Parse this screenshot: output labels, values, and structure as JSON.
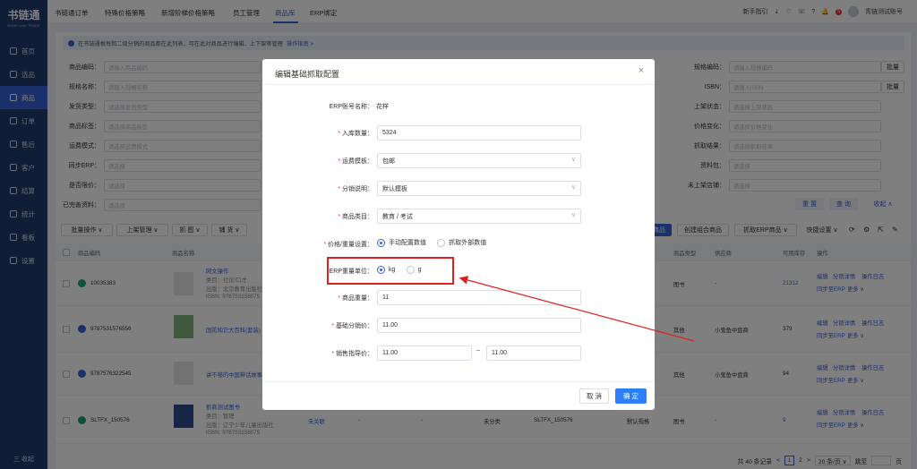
{
  "app": {
    "logo": "书链通",
    "logo_sub": "BOOK LINK TRADE"
  },
  "sidebar": {
    "items": [
      {
        "label": "首页",
        "active": false
      },
      {
        "label": "选品",
        "active": false
      },
      {
        "label": "商品",
        "active": true
      },
      {
        "label": "订单",
        "active": false
      },
      {
        "label": "售后",
        "active": false
      },
      {
        "label": "客户",
        "active": false
      },
      {
        "label": "结算",
        "active": false
      },
      {
        "label": "统计",
        "active": false
      },
      {
        "label": "看板",
        "active": false
      },
      {
        "label": "设置",
        "active": false
      }
    ],
    "collapse": "三 收起"
  },
  "topbar": {
    "tabs": [
      "书链通订单",
      "特殊价格策略",
      "新增阶梯价格策略",
      "员工管理",
      "商品库",
      "ERP绑定"
    ],
    "active_tab": "商品库",
    "guide": "新手指引",
    "badge": "5",
    "user": "青链测试账号"
  },
  "notice": {
    "text": "在书链通根每和二级分销的商品都在此列表，可在此对商品进行编辑、上下架等管理",
    "link": "操作指南 >"
  },
  "filters": {
    "left": [
      {
        "label": "商品编码：",
        "placeholder": "请输入商品编码"
      },
      {
        "label": "规格名称：",
        "placeholder": "请输入规格名称"
      },
      {
        "label": "发货类型：",
        "placeholder": "请选择发货类型"
      },
      {
        "label": "商品标签：",
        "placeholder": "请选择商品标签"
      },
      {
        "label": "运费模式：",
        "placeholder": "请选择运费模式"
      },
      {
        "label": "同步ERP：",
        "placeholder": "请选择"
      },
      {
        "label": "是否限价：",
        "placeholder": "请选择"
      }
    ],
    "right": [
      {
        "label": "规格编码：",
        "placeholder": "请输入规格编码"
      },
      {
        "label": "ISBN：",
        "placeholder": "请输入ISBN"
      },
      {
        "label": "上架状态：",
        "placeholder": "请选择上架状态"
      },
      {
        "label": "价格变化：",
        "placeholder": "请选择价格变化"
      },
      {
        "label": "抓取结果：",
        "placeholder": "请选择抓取结果"
      },
      {
        "label": "资料包：",
        "placeholder": "请选择"
      },
      {
        "label": "未上架店铺：",
        "placeholder": "请选择"
      }
    ],
    "batch": "批量",
    "complete_label": "已完善资料：",
    "complete_placeholder": "请选择",
    "reset": "重 置",
    "search": "查 询",
    "fold": "收起 ∧"
  },
  "toolbar": {
    "left": [
      "批量操作 ∨",
      "上架管理 ∨",
      "抓 图 ∨",
      "铺 货 ∨"
    ],
    "right": [
      "商品",
      "创建组合商品",
      "抓取ERP商品 ∨",
      "快捷设置 ∨"
    ]
  },
  "table": {
    "headers": [
      "商品编码",
      "商品名称",
      "商品类型",
      "供应商",
      "可用库存",
      "操作"
    ],
    "rows": [
      {
        "code": "10035383",
        "name": "网文操作",
        "meta": [
          "类目：社论/口才",
          "出版：北京教育出版社",
          "ISBN: 978753158075"
        ],
        "type": "图书",
        "supplier": "-",
        "stock": "21312",
        "stock_link": true
      },
      {
        "code": "9787531576556",
        "name": "国防知识大百科(套装)",
        "meta": [],
        "type": "其他",
        "supplier": "小鬼鱼中盘商",
        "stock": "379",
        "stock_link": false
      },
      {
        "code": "9787576322545",
        "name": "讲不够的中国神话故事",
        "meta": [],
        "type": "其他",
        "supplier": "小鬼鱼中盘商",
        "stock": "94",
        "stock_link": false
      },
      {
        "code": "SLTFX_150576",
        "name": "抓商测试图书",
        "meta": [
          "类目：管理",
          "出版：辽宁少年儿童出版社",
          "ISBN: 978753158075"
        ],
        "type": "图书",
        "supplier": "-",
        "stock": "9",
        "stock_link": true,
        "extra": [
          "未关联",
          "-",
          "-",
          "未分类",
          "SLTFX_150576",
          "默认规格"
        ]
      }
    ],
    "ops": [
      "编辑",
      "分销详情",
      "操作日志",
      "同步至ERP",
      "更多 ∨"
    ]
  },
  "pager": {
    "total": "共 40 条记录",
    "prev": "<",
    "page1": "1",
    "page2": "2",
    "next": ">",
    "size": "20 条/页 ∨",
    "goto": "跳至",
    "page_unit": "页"
  },
  "modal": {
    "title": "编辑基础抓取配置",
    "close": "×",
    "erp_label": "ERP账号名称：",
    "erp_value": "花样",
    "stock_label": "入库数量：",
    "stock_value": "5324",
    "freight_label": "运费模板：",
    "freight_value": "包邮",
    "dist_label": "分销说明：",
    "dist_value": "默认模板",
    "cat_label": "商品类目：",
    "cat_value": "教育 / 考试",
    "price_label": "价格/重量设置：",
    "price_opt1": "手动配置数值",
    "price_opt2": "抓取外部数值",
    "unit_label": "ERP重量单位：",
    "unit_kg": "kg",
    "unit_g": "g",
    "weight_label": "商品重量：",
    "weight_value": "11",
    "base_price_label": "基础分销价：",
    "base_price_value": "11.00",
    "guide_price_label": "销售指导价：",
    "guide_min": "11.00",
    "range_sep": "~",
    "guide_max": "11.00",
    "cancel": "取 消",
    "ok": "确 定"
  },
  "colors": {
    "accent": "#3662d8",
    "sidebar": "#1f3a6d",
    "highlight": "#e02020"
  }
}
